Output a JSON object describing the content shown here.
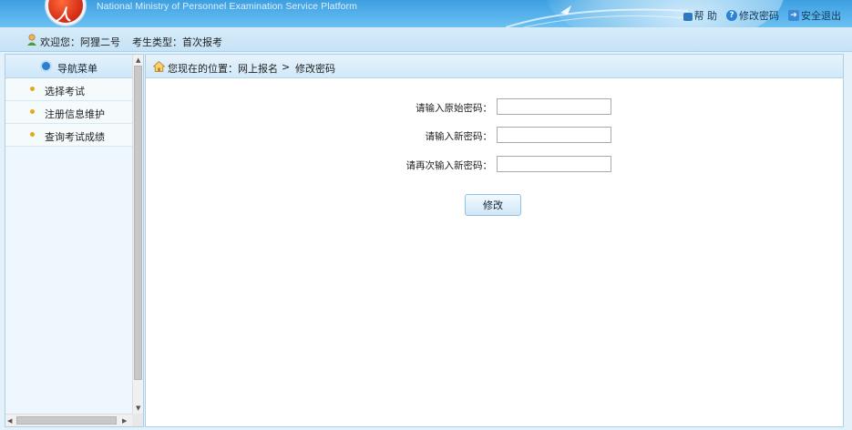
{
  "header": {
    "logo_text": "人社",
    "subtitle": "National Ministry of Personnel Examination Service Platform",
    "links": {
      "help": "帮 助",
      "change_password": "修改密码",
      "logout": "安全退出"
    }
  },
  "welcome": {
    "greeting": "欢迎您：阿狸二号",
    "exam_type": "考生类型：首次报考"
  },
  "sidebar": {
    "title": "导航菜单",
    "items": [
      {
        "label": "选择考试"
      },
      {
        "label": "注册信息维护"
      },
      {
        "label": "查询考试成绩"
      }
    ]
  },
  "breadcrumb": {
    "prefix": "您现在的位置：网上报名",
    "separator": ">",
    "current": "修改密码"
  },
  "form": {
    "old_password_label": "请输入原始密码：",
    "old_password_value": "",
    "new_password_label": "请输入新密码：",
    "new_password_value": "",
    "confirm_password_label": "请再次输入新密码：",
    "confirm_password_value": "",
    "submit_label": "修改"
  },
  "colors": {
    "header_blue": "#56b2ec",
    "menu_bullet": "#e7a818",
    "panel_border": "#a9cfe9"
  }
}
